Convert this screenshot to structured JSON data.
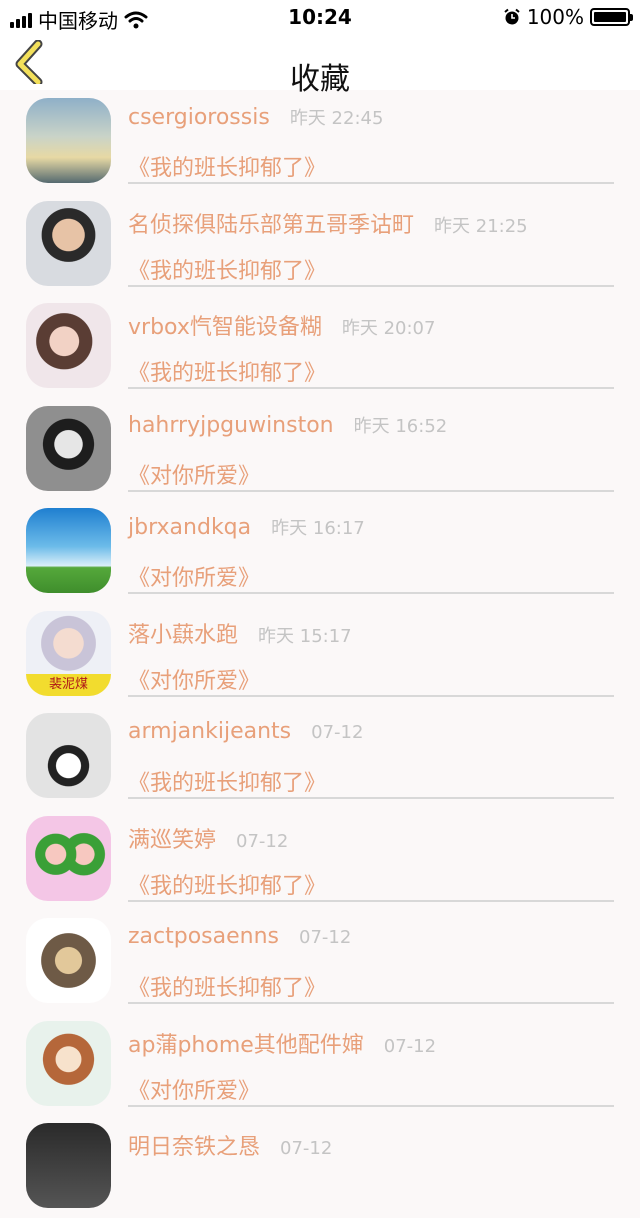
{
  "status_bar": {
    "carrier": "中国移动",
    "time": "10:24",
    "battery": "100%"
  },
  "nav": {
    "title": "收藏",
    "back_icon": "chevron-left-icon"
  },
  "items": [
    {
      "name": "csergiorossis",
      "time": "昨天 22:45",
      "title": "《我的班长抑郁了》"
    },
    {
      "name": "名侦探俱陆乐部第五哥季诂町",
      "time": "昨天 21:25",
      "title": "《我的班长抑郁了》"
    },
    {
      "name": "vrbox忾智能设备糊",
      "time": "昨天 20:07",
      "title": "《我的班长抑郁了》"
    },
    {
      "name": "hahrryjpguwinston",
      "time": "昨天 16:52",
      "title": "《对你所爱》"
    },
    {
      "name": "jbrxandkqa",
      "time": "昨天 16:17",
      "title": "《对你所爱》"
    },
    {
      "name": "落小蕻水跑",
      "time": "昨天 15:17",
      "title": "《对你所爱》",
      "avatar_caption": "裴泥煤"
    },
    {
      "name": "armjankijeants",
      "time": "07-12",
      "title": "《我的班长抑郁了》"
    },
    {
      "name": "满巡笑婷",
      "time": "07-12",
      "title": "《我的班长抑郁了》"
    },
    {
      "name": "zactposaenns",
      "time": "07-12",
      "title": "《我的班长抑郁了》"
    },
    {
      "name": "ap蒲phome其他配件婶",
      "time": "07-12",
      "title": "《对你所爱》"
    },
    {
      "name": "明日奈铁之恳",
      "time": "07-12",
      "title": ""
    }
  ]
}
